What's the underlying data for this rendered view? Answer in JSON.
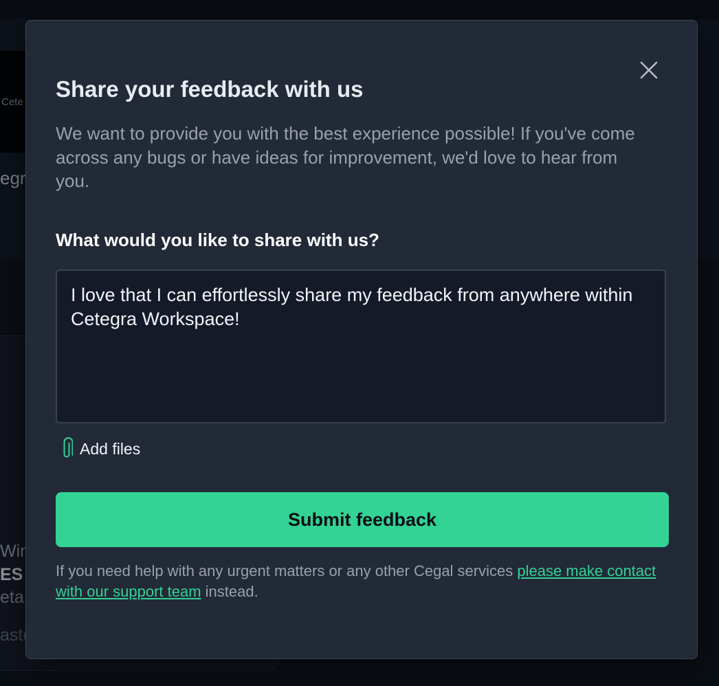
{
  "background": {
    "thumbnail_text": "Cete",
    "subtitle_fragment": "egr",
    "card_lines": [
      "Wind",
      "ES",
      "eta",
      "asto"
    ]
  },
  "modal": {
    "title": "Share your feedback with us",
    "description": "We want to provide you with the best experience possible! If you've come across any bugs or have ideas for improvement, we'd love to hear from you.",
    "close_icon": "close-icon",
    "question_label": "What would you like to share with us?",
    "feedback_text": "I love that I can effortlessly share my feedback from anywhere within Cetegra Workspace!",
    "add_files_icon": "paperclip-icon",
    "add_files_label": "Add files",
    "submit_label": "Submit feedback",
    "footer_text_before": "If you need help with any urgent matters or any other Cegal services ",
    "footer_link_text": "please make contact with our support team",
    "footer_text_after": " instead."
  },
  "colors": {
    "accent": "#33d295",
    "modal_bg": "#222937",
    "input_bg": "#141a28",
    "page_bg": "#0e121b"
  }
}
